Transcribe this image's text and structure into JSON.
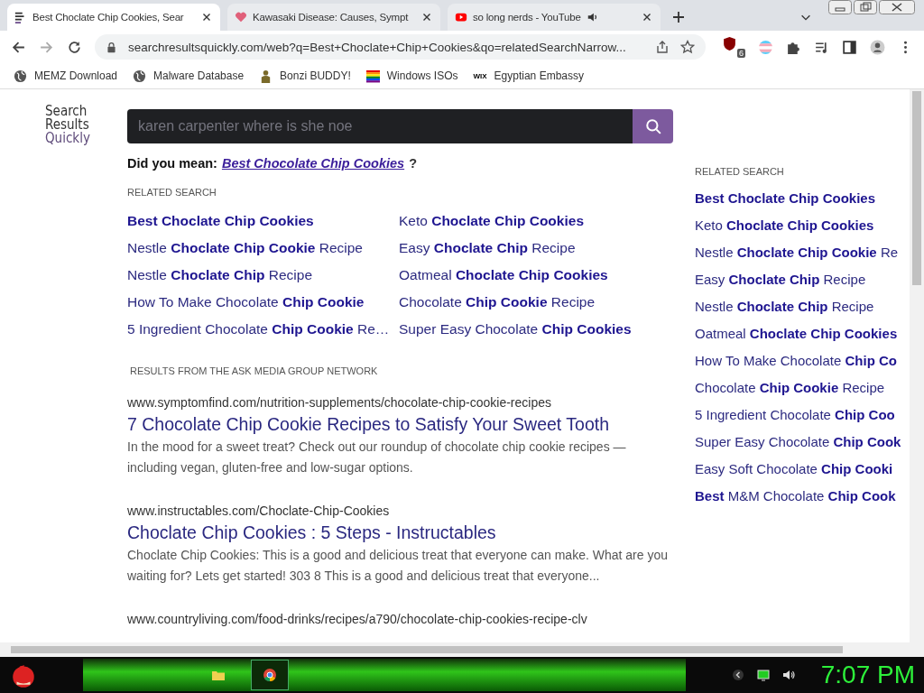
{
  "tabs": [
    {
      "title": "Best Choclate Chip Cookies, Sear",
      "kind": "logo",
      "selected": true,
      "audio": false
    },
    {
      "title": "Kawasaki Disease: Causes, Sympt",
      "kind": "heart",
      "selected": false,
      "audio": false
    },
    {
      "title": "so long nerds - YouTube",
      "kind": "video",
      "selected": false,
      "audio": true
    }
  ],
  "address": {
    "url": "searchresultsquickly.com/web?q=Best+Choclate+Chip+Cookies&qo=relatedSearchNarrow...",
    "extension_badge": "6"
  },
  "bookmarks": [
    {
      "label": "MEMZ Download",
      "kind": "globe"
    },
    {
      "label": "Malware Database",
      "kind": "globe"
    },
    {
      "label": "Bonzi BUDDY!",
      "kind": "figure"
    },
    {
      "label": "Windows ISOs",
      "kind": "rainbow"
    },
    {
      "label": "Egyptian Embassy",
      "kind": "text",
      "icon_text": "WIX"
    }
  ],
  "logo": [
    "Search",
    "Results",
    "Quickly"
  ],
  "search": {
    "value": "karen carpenter where is she noe"
  },
  "did_you_mean": {
    "label": "Did you mean:",
    "suggestion": "Best Chocolate Chip Cookies",
    "mark": "?"
  },
  "related_heading": "RELATED SEARCH",
  "related": [
    "**Best Choclate Chip Cookies**",
    "Keto **Choclate Chip Cookies**",
    "Nestle **Choclate Chip Cookie** Recipe",
    "Easy **Choclate Chip** Recipe",
    "Nestle **Choclate Chip** Recipe",
    "Oatmeal **Choclate Chip Cookies**",
    "How To Make Chocolate **Chip Cookie**",
    "Chocolate **Chip Cookie** Recipe",
    "5 Ingredient Chocolate **Chip Cookie** Re…",
    "Super Easy Chocolate **Chip Cookies**"
  ],
  "results_heading": "RESULTS FROM THE ASK MEDIA GROUP NETWORK",
  "results": [
    {
      "url": "www.symptomfind.com/nutrition-supplements/chocolate-chip-cookie-recipes",
      "title": "7 Chocolate Chip Cookie Recipes to Satisfy Your Sweet Tooth",
      "snippet": "In the mood for a sweet treat? Check out our roundup of chocolate chip cookie recipes — including vegan, gluten-free and low-sugar options."
    },
    {
      "url": "www.instructables.com/Choclate-Chip-Cookies",
      "title": "Choclate Chip Cookies : 5 Steps - Instructables",
      "snippet": "Choclate Chip Cookies: This is a good and delicious treat that everyone can make. What are you waiting for? Lets get started! 303 8 This is a good and delicious treat that everyone..."
    },
    {
      "url": "www.countryliving.com/food-drinks/recipes/a790/chocolate-chip-cookies-recipe-clv"
    }
  ],
  "sidebar": {
    "heading": "RELATED SEARCH",
    "items": [
      "**Best Choclate Chip Cookies**",
      "Keto **Choclate Chip Cookies**",
      "Nestle **Choclate Chip Cookie** Re",
      "Easy **Choclate Chip** Recipe",
      "Nestle **Choclate Chip** Recipe",
      "Oatmeal **Choclate Chip Cookies**",
      "How To Make Chocolate **Chip Co**",
      "Chocolate **Chip Cookie** Recipe",
      "5 Ingredient Chocolate **Chip Coo**",
      "Super Easy Chocolate **Chip Cook**",
      "Easy Soft Chocolate **Chip Cooki**",
      "**Best** M&M Chocolate **Chip Cook**"
    ]
  },
  "taskbar": {
    "clock": "7:07 PM",
    "apps": [
      {
        "kind": "folder",
        "selected": false
      },
      {
        "kind": "browser",
        "selected": true
      }
    ]
  }
}
